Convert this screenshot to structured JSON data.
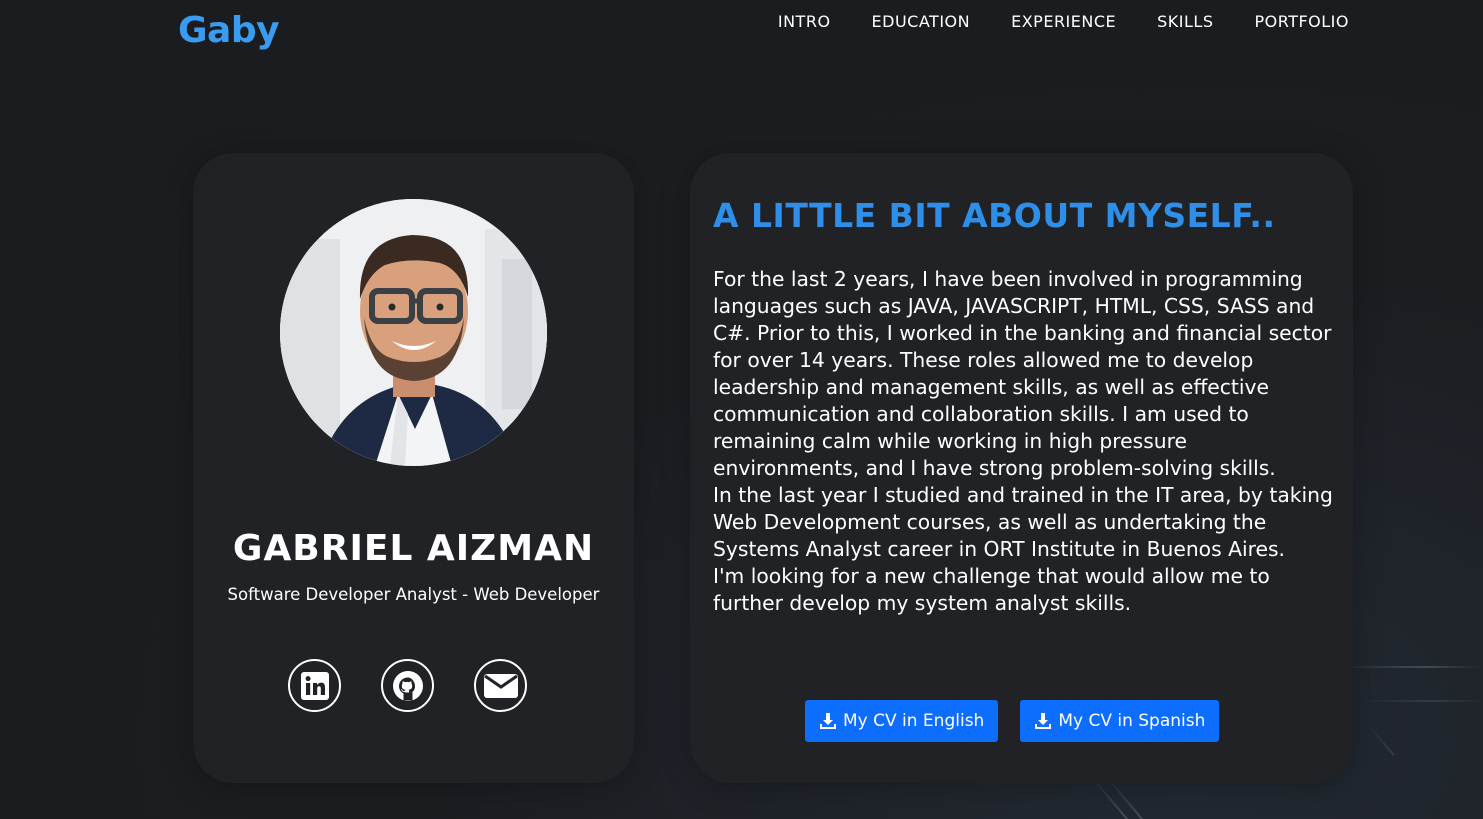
{
  "header": {
    "logo": "Gaby",
    "nav": [
      "INTRO",
      "EDUCATION",
      "EXPERIENCE",
      "SKILLS",
      "PORTFOLIO"
    ]
  },
  "profile": {
    "name": "GABRIEL AIZMAN",
    "role": "Software Developer Analyst - Web Developer",
    "socials": [
      "linkedin-icon",
      "github-icon",
      "email-icon"
    ]
  },
  "about": {
    "title": "A LITTLE BIT ABOUT MYSELF..",
    "paragraphs": [
      "For the last 2 years, I have been involved in programming languages such as JAVA, JAVASCRIPT, HTML, CSS, SASS and C#. Prior to this, I worked in the banking and financial sector for over 14 years. These roles allowed me to develop leadership and management skills, as well as effective communication and collaboration skills. I am used to remaining calm while working in high pressure environments, and I have strong problem-solving skills.",
      "In the last year I studied and trained in the IT area, by taking Web Development courses, as well as undertaking the Systems Analyst career in ORT Institute in Buenos Aires.",
      "I'm looking for a new challenge that would allow me to further develop my system analyst skills."
    ],
    "buttons": {
      "cv_english": "My CV in English",
      "cv_spanish": "My CV in Spanish"
    }
  },
  "colors": {
    "accent": "#2f8fe8",
    "button": "#0d6efd",
    "background": "#1b1d21",
    "card": "#202226"
  }
}
